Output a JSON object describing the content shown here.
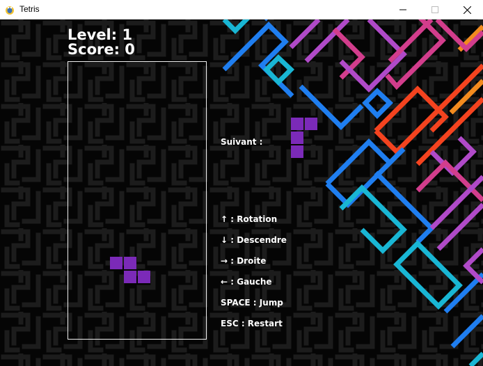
{
  "window": {
    "title": "Tetris"
  },
  "hud": {
    "level_label": "Level: 1",
    "score_label": "Score: 0"
  },
  "next": {
    "label": "Suivant :"
  },
  "controls": [
    {
      "icon": "arrow-up-icon",
      "glyph": "↑",
      "text": " : Rotation"
    },
    {
      "icon": "arrow-down-icon",
      "glyph": "↓",
      "text": " : Descendre"
    },
    {
      "icon": "arrow-right-icon",
      "glyph": "→",
      "text": " : Droite"
    },
    {
      "icon": "arrow-left-icon",
      "glyph": "←",
      "text": " : Gauche"
    },
    {
      "icon": "",
      "glyph": "",
      "text": "SPACE : Jump"
    },
    {
      "icon": "",
      "glyph": "",
      "text": "ESC : Restart"
    }
  ],
  "colors": {
    "piece": "#7b2ab8",
    "board_border": "#f0f0f0"
  }
}
